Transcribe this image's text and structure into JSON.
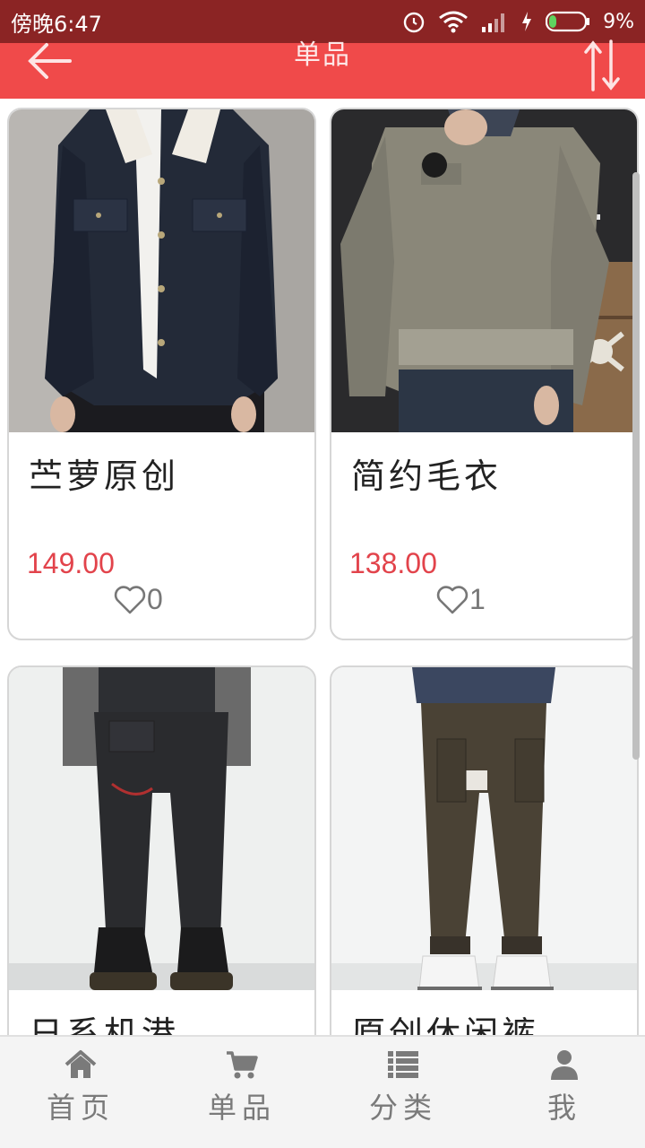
{
  "status_bar": {
    "time": "傍晚6:47",
    "battery": "9%"
  },
  "app_bar": {
    "title": "单品"
  },
  "products": [
    {
      "name": "苎萝原创",
      "price": "149.00",
      "likes": "0"
    },
    {
      "name": "简约毛衣",
      "price": "138.00",
      "likes": "1"
    },
    {
      "name": "日系机港",
      "price": "",
      "likes": ""
    },
    {
      "name": "原创休闲裤",
      "price": "",
      "likes": ""
    }
  ],
  "bottom_nav": [
    {
      "label": "首页",
      "icon": "home-icon"
    },
    {
      "label": "单品",
      "icon": "cart-icon"
    },
    {
      "label": "分类",
      "icon": "list-icon"
    },
    {
      "label": "我",
      "icon": "user-icon"
    }
  ]
}
